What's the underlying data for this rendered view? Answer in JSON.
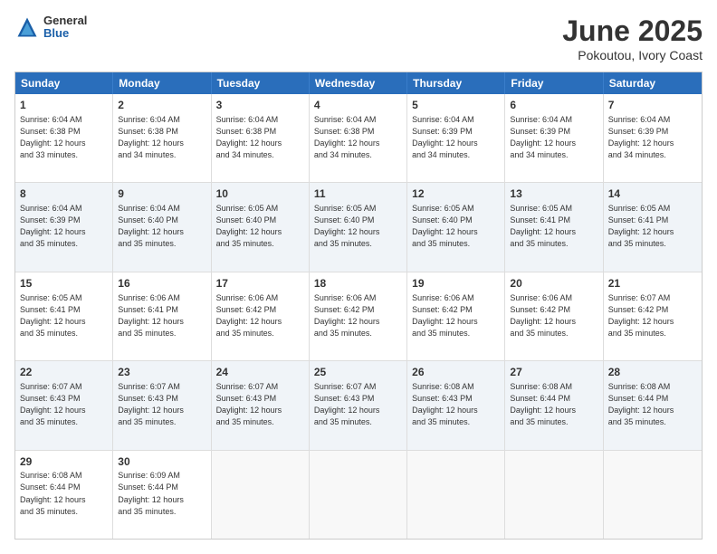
{
  "header": {
    "logo": {
      "general": "General",
      "blue": "Blue"
    },
    "title": "June 2025",
    "subtitle": "Pokoutou, Ivory Coast"
  },
  "calendar": {
    "days": [
      "Sunday",
      "Monday",
      "Tuesday",
      "Wednesday",
      "Thursday",
      "Friday",
      "Saturday"
    ],
    "rows": [
      [
        {
          "day": "1",
          "info": "Sunrise: 6:04 AM\nSunset: 6:38 PM\nDaylight: 12 hours\nand 33 minutes."
        },
        {
          "day": "2",
          "info": "Sunrise: 6:04 AM\nSunset: 6:38 PM\nDaylight: 12 hours\nand 34 minutes."
        },
        {
          "day": "3",
          "info": "Sunrise: 6:04 AM\nSunset: 6:38 PM\nDaylight: 12 hours\nand 34 minutes."
        },
        {
          "day": "4",
          "info": "Sunrise: 6:04 AM\nSunset: 6:38 PM\nDaylight: 12 hours\nand 34 minutes."
        },
        {
          "day": "5",
          "info": "Sunrise: 6:04 AM\nSunset: 6:39 PM\nDaylight: 12 hours\nand 34 minutes."
        },
        {
          "day": "6",
          "info": "Sunrise: 6:04 AM\nSunset: 6:39 PM\nDaylight: 12 hours\nand 34 minutes."
        },
        {
          "day": "7",
          "info": "Sunrise: 6:04 AM\nSunset: 6:39 PM\nDaylight: 12 hours\nand 34 minutes."
        }
      ],
      [
        {
          "day": "8",
          "info": "Sunrise: 6:04 AM\nSunset: 6:39 PM\nDaylight: 12 hours\nand 35 minutes."
        },
        {
          "day": "9",
          "info": "Sunrise: 6:04 AM\nSunset: 6:40 PM\nDaylight: 12 hours\nand 35 minutes."
        },
        {
          "day": "10",
          "info": "Sunrise: 6:05 AM\nSunset: 6:40 PM\nDaylight: 12 hours\nand 35 minutes."
        },
        {
          "day": "11",
          "info": "Sunrise: 6:05 AM\nSunset: 6:40 PM\nDaylight: 12 hours\nand 35 minutes."
        },
        {
          "day": "12",
          "info": "Sunrise: 6:05 AM\nSunset: 6:40 PM\nDaylight: 12 hours\nand 35 minutes."
        },
        {
          "day": "13",
          "info": "Sunrise: 6:05 AM\nSunset: 6:41 PM\nDaylight: 12 hours\nand 35 minutes."
        },
        {
          "day": "14",
          "info": "Sunrise: 6:05 AM\nSunset: 6:41 PM\nDaylight: 12 hours\nand 35 minutes."
        }
      ],
      [
        {
          "day": "15",
          "info": "Sunrise: 6:05 AM\nSunset: 6:41 PM\nDaylight: 12 hours\nand 35 minutes."
        },
        {
          "day": "16",
          "info": "Sunrise: 6:06 AM\nSunset: 6:41 PM\nDaylight: 12 hours\nand 35 minutes."
        },
        {
          "day": "17",
          "info": "Sunrise: 6:06 AM\nSunset: 6:42 PM\nDaylight: 12 hours\nand 35 minutes."
        },
        {
          "day": "18",
          "info": "Sunrise: 6:06 AM\nSunset: 6:42 PM\nDaylight: 12 hours\nand 35 minutes."
        },
        {
          "day": "19",
          "info": "Sunrise: 6:06 AM\nSunset: 6:42 PM\nDaylight: 12 hours\nand 35 minutes."
        },
        {
          "day": "20",
          "info": "Sunrise: 6:06 AM\nSunset: 6:42 PM\nDaylight: 12 hours\nand 35 minutes."
        },
        {
          "day": "21",
          "info": "Sunrise: 6:07 AM\nSunset: 6:42 PM\nDaylight: 12 hours\nand 35 minutes."
        }
      ],
      [
        {
          "day": "22",
          "info": "Sunrise: 6:07 AM\nSunset: 6:43 PM\nDaylight: 12 hours\nand 35 minutes."
        },
        {
          "day": "23",
          "info": "Sunrise: 6:07 AM\nSunset: 6:43 PM\nDaylight: 12 hours\nand 35 minutes."
        },
        {
          "day": "24",
          "info": "Sunrise: 6:07 AM\nSunset: 6:43 PM\nDaylight: 12 hours\nand 35 minutes."
        },
        {
          "day": "25",
          "info": "Sunrise: 6:07 AM\nSunset: 6:43 PM\nDaylight: 12 hours\nand 35 minutes."
        },
        {
          "day": "26",
          "info": "Sunrise: 6:08 AM\nSunset: 6:43 PM\nDaylight: 12 hours\nand 35 minutes."
        },
        {
          "day": "27",
          "info": "Sunrise: 6:08 AM\nSunset: 6:44 PM\nDaylight: 12 hours\nand 35 minutes."
        },
        {
          "day": "28",
          "info": "Sunrise: 6:08 AM\nSunset: 6:44 PM\nDaylight: 12 hours\nand 35 minutes."
        }
      ],
      [
        {
          "day": "29",
          "info": "Sunrise: 6:08 AM\nSunset: 6:44 PM\nDaylight: 12 hours\nand 35 minutes."
        },
        {
          "day": "30",
          "info": "Sunrise: 6:09 AM\nSunset: 6:44 PM\nDaylight: 12 hours\nand 35 minutes."
        },
        {
          "day": "",
          "info": ""
        },
        {
          "day": "",
          "info": ""
        },
        {
          "day": "",
          "info": ""
        },
        {
          "day": "",
          "info": ""
        },
        {
          "day": "",
          "info": ""
        }
      ]
    ]
  }
}
